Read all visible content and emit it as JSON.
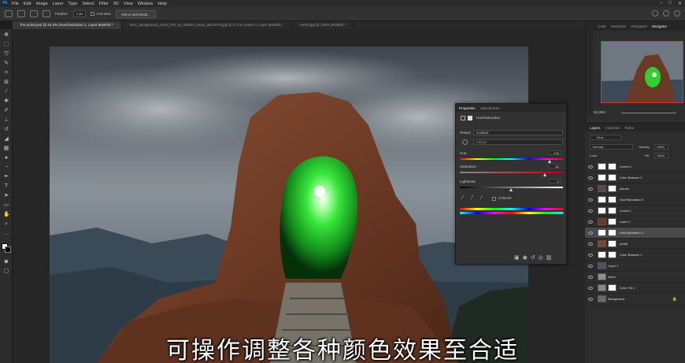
{
  "menubar": {
    "logo": "Ps",
    "items": [
      "File",
      "Edit",
      "Image",
      "Layer",
      "Type",
      "Select",
      "Filter",
      "3D",
      "View",
      "Window",
      "Help"
    ]
  },
  "options": {
    "feather_label": "Feather:",
    "feather_value": "1 px",
    "antialias_label": "Anti-alias",
    "select_mask_label": "Select and Mask..."
  },
  "doc_tabs": [
    "the portal.psd @ 53,3% (Hue/Saturation 2, Layer Mask/8) *",
    "misc_background_stock_078_by_malleni_stock_dac157m.jpg @ 17,1% (Layer 0, Layer Mask/8) *",
    "Portal.jpg @ 100% (RGB/8) *"
  ],
  "right_tabs": [
    "Color",
    "Swatches",
    "Histogram",
    "Navigator"
  ],
  "navigator": {
    "zoom": "53,28%"
  },
  "properties": {
    "tabs": [
      "Properties",
      "Adjustments"
    ],
    "title": "Hue/Saturation",
    "preset_label": "Preset:",
    "preset_value": "Custom",
    "channel_value": "Master",
    "hue_label": "Hue:",
    "hue_value": "136",
    "saturation_label": "Saturation:",
    "saturation_value": "65",
    "lightness_label": "Lightness:",
    "lightness_value": "0",
    "colorize_label": "Colorize"
  },
  "layers": {
    "tabs": [
      "Layers",
      "Channels",
      "Paths"
    ],
    "kind_label": "Kind",
    "blend_mode": "Normal",
    "opacity_label": "Opacity:",
    "opacity_value": "100%",
    "lock_label": "Lock:",
    "fill_label": "Fill:",
    "fill_value": "100%",
    "items": [
      {
        "name": "Levels 2",
        "selected": false
      },
      {
        "name": "Color Balance 2",
        "selected": false
      },
      {
        "name": "stones",
        "selected": false
      },
      {
        "name": "Hue/Saturation 3",
        "selected": false
      },
      {
        "name": "Levels 1",
        "selected": false
      },
      {
        "name": "Layer 2",
        "selected": false
      },
      {
        "name": "Hue/Saturation 2",
        "selected": true
      },
      {
        "name": "portal",
        "selected": false
      },
      {
        "name": "Color Balance 1",
        "selected": false
      },
      {
        "name": "Layer 1",
        "selected": false
      },
      {
        "name": "cloud",
        "selected": false
      },
      {
        "name": "Color Fill 1",
        "selected": false
      },
      {
        "name": "Background",
        "selected": false
      }
    ]
  },
  "subtitle": "可操作调整各种颜色效果至合适",
  "colors": {
    "accent": "#31a8ff",
    "portal_green": "#39ff3a"
  }
}
